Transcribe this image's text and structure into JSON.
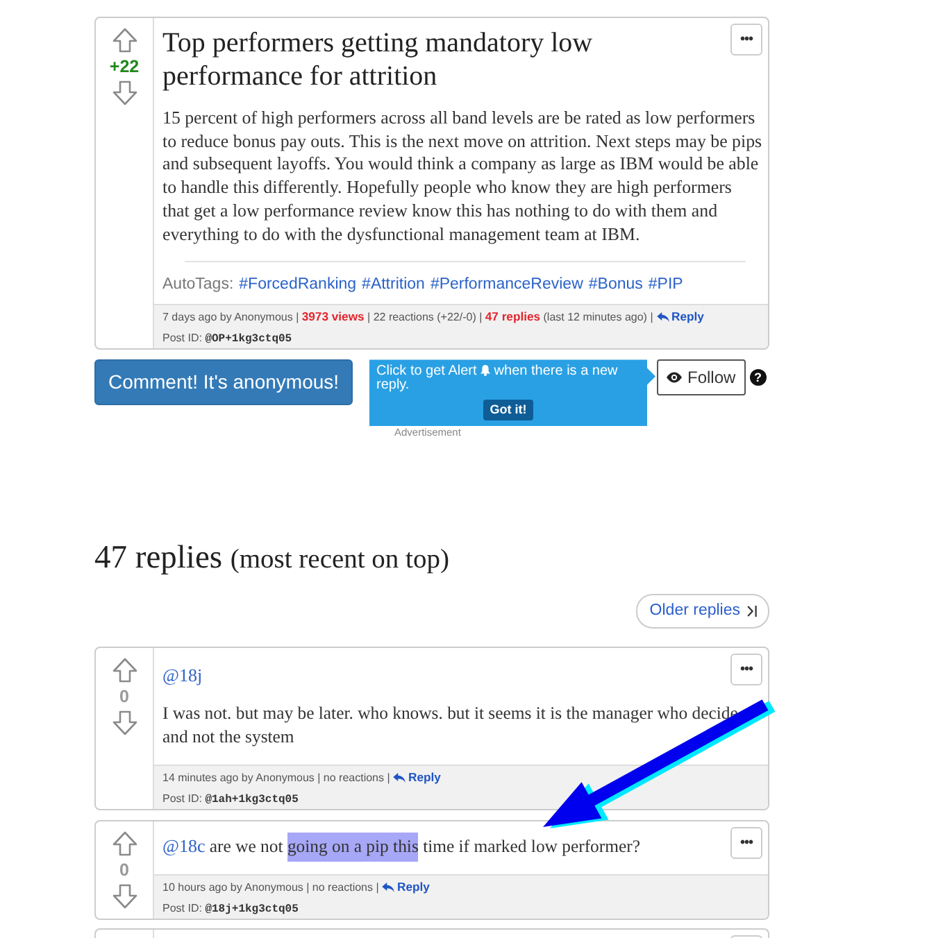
{
  "post": {
    "score": "+22",
    "color": "#22881f",
    "menu": "•••",
    "title": "Top performers getting mandatory low performance for attrition",
    "body": "15 percent of high performers across all band levels are be rated as low performers to reduce bonus pay outs. This is the next move on attrition. Next steps may be pips and subsequent layoffs. You would think a company as large as IBM would be able to handle this differently. Hopefully people who know they are high performers that get a low performance review know this has nothing to do with them and everything to do with the dysfunctional management team at IBM.",
    "autotags_label": "AutoTags:",
    "tags": [
      "#ForcedRanking",
      "#Attrition",
      "#PerformanceReview",
      "#Bonus",
      "#PIP"
    ],
    "meta": "7 days ago by Anonymous | **3973 views** | 22 reactions (+22/-0) | **47 replies** (last 12 minutes ago) |",
    "reply_link": "Reply",
    "post_id_label": "Post ID:",
    "post_id": "@OP+1kg3ctq05"
  },
  "actions": {
    "comment_button": "Comment! It's anonymous!",
    "alert_tooltip": {
      "text_before": "Click to get Alert",
      "text_after": "when there is a new reply.",
      "button": "Got it!"
    },
    "advertisement": "Advertisement",
    "follow_button": "Follow",
    "help": "?"
  },
  "replies_heading": {
    "count": "47 replies",
    "note": "(most recent on top)"
  },
  "older_replies": "Older replies",
  "replies": [
    {
      "kind": "full",
      "score": "0",
      "color": "#999999",
      "menu": "•••",
      "mention": "@18j",
      "mention_on_own_line": true,
      "text_parts": [
        {
          "text": "I was not. but may be later. who knows. but it seems it is the manager who decide and not the system",
          "highlighted": false
        }
      ],
      "meta": "14 minutes ago by Anonymous | no reactions |",
      "reply_link": "Reply",
      "post_id_label": "Post ID:",
      "post_id": "@1ah+1kg3ctq05"
    },
    {
      "kind": "full",
      "score": "0",
      "color": "#999999",
      "menu": "•••",
      "mention": "@18c",
      "mention_on_own_line": false,
      "text_parts": [
        {
          "text": "are we not ",
          "highlighted": false
        },
        {
          "text": "going on a pip this",
          "highlighted": true
        },
        {
          "text": " time if marked low performer?",
          "highlighted": false
        }
      ],
      "meta": "10 hours ago by Anonymous | no reactions |",
      "reply_link": "Reply",
      "post_id_label": "Post ID:",
      "post_id": "@18j+1kg3ctq05"
    },
    {
      "kind": "partial"
    }
  ],
  "annotation": {
    "kind": "arrow"
  }
}
